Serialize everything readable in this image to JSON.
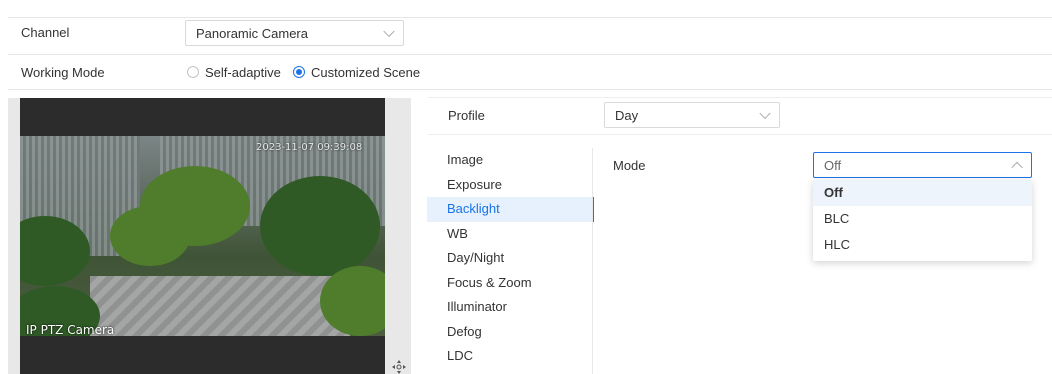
{
  "form": {
    "channel_label": "Channel",
    "channel_value": "Panoramic Camera",
    "working_mode_label": "Working Mode",
    "working_mode_options": [
      {
        "label": "Self-adaptive",
        "selected": false
      },
      {
        "label": "Customized Scene",
        "selected": true
      }
    ]
  },
  "video": {
    "osd_title": "IP PTZ Camera",
    "osd_time": "2023-11-07 09:39:08"
  },
  "settings": {
    "profile_label": "Profile",
    "profile_value": "Day",
    "menu": [
      "Image",
      "Exposure",
      "Backlight",
      "WB",
      "Day/Night",
      "Focus & Zoom",
      "Illuminator",
      "Defog",
      "LDC"
    ],
    "active_menu": "Backlight",
    "mode_label": "Mode",
    "mode_value": "Off",
    "mode_options": [
      "Off",
      "BLC",
      "HLC"
    ]
  },
  "colors": {
    "accent": "#1a73e8",
    "active_bg": "#e6f1fd"
  }
}
